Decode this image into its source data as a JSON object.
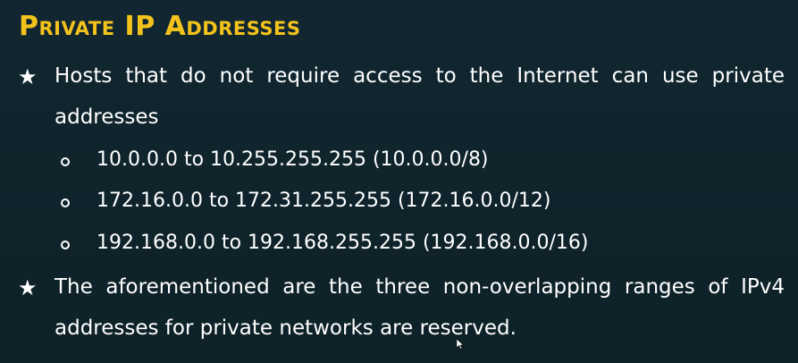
{
  "slide": {
    "title": "Private IP Addresses",
    "bullets": [
      {
        "text": "Hosts that do not require access to the Internet can use private addresses",
        "sub_items": [
          "10.0.0.0 to 10.255.255.255 (10.0.0.0/8)",
          "172.16.0.0 to 172.31.255.255 (172.16.0.0/12)",
          "192.168.0.0 to 192.168.255.255 (192.168.0.0/16)"
        ]
      },
      {
        "text": "The aforementioned are the three non-overlapping ranges of IPv4 addresses for private networks are reserved."
      }
    ]
  },
  "colors": {
    "background": "#0f2229",
    "title": "#f3c31c",
    "text": "#ffffff"
  },
  "icons": {
    "bullet_primary": "star-icon",
    "bullet_secondary": "hollow-circle-icon",
    "pointer": "mouse-cursor-icon"
  }
}
